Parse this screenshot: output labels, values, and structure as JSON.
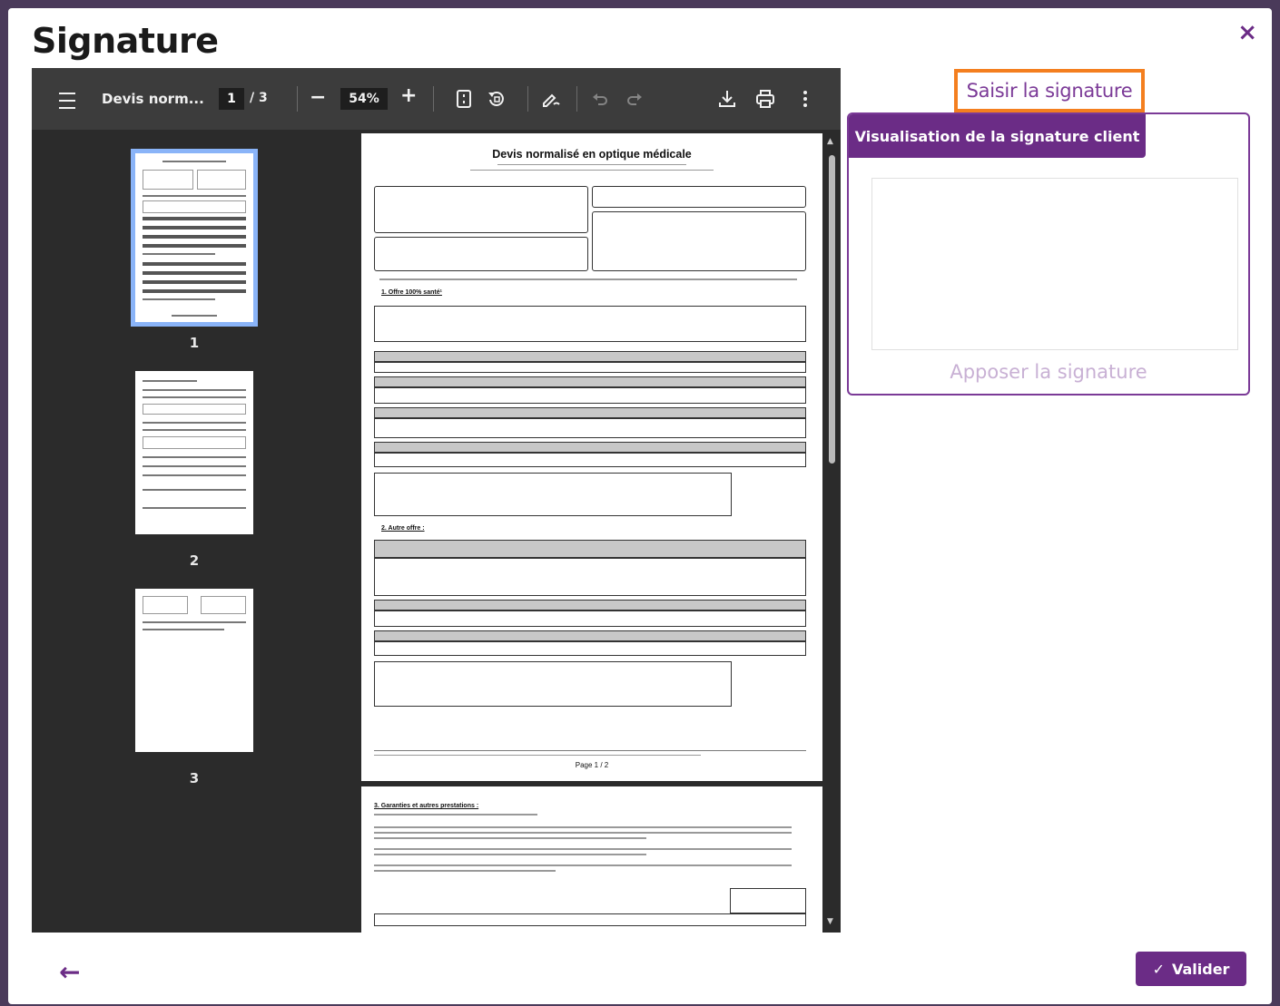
{
  "modal": {
    "title": "Signature",
    "close_symbol": "×"
  },
  "viewer": {
    "doc_name": "Devis norm...",
    "current_page": "1",
    "total_pages": "/ 3",
    "zoom": "54%",
    "minus_symbol": "−",
    "plus_symbol": "+",
    "icons": [
      "menu-icon",
      "fit-page-icon",
      "rotate-icon",
      "annotate-icon",
      "undo-icon",
      "redo-icon",
      "download-icon",
      "print-icon",
      "more-icon"
    ],
    "thumbnails": [
      {
        "label": "1"
      },
      {
        "label": "2"
      },
      {
        "label": "3"
      }
    ],
    "page1": {
      "title": "Devis normalisé en optique médicale",
      "section1": "1. Offre 100% santé¹",
      "section2": "2. Autre offre :",
      "footer": "Page 1 / 2"
    },
    "page2": {
      "section3": "3. Garanties et autres prestations :"
    }
  },
  "signature": {
    "saisir_label": "Saisir la signature",
    "tab_label": "Visualisation de la signature client",
    "apply_label": "Apposer la signature"
  },
  "footer": {
    "back_symbol": "←",
    "validate_label": "Valider",
    "validate_check": "✓"
  },
  "colors": {
    "accent": "#6b2c86",
    "highlight": "#f47f1f",
    "viewer_bg": "#2b2b2b",
    "toolbar_bg": "#3c3c3c"
  }
}
